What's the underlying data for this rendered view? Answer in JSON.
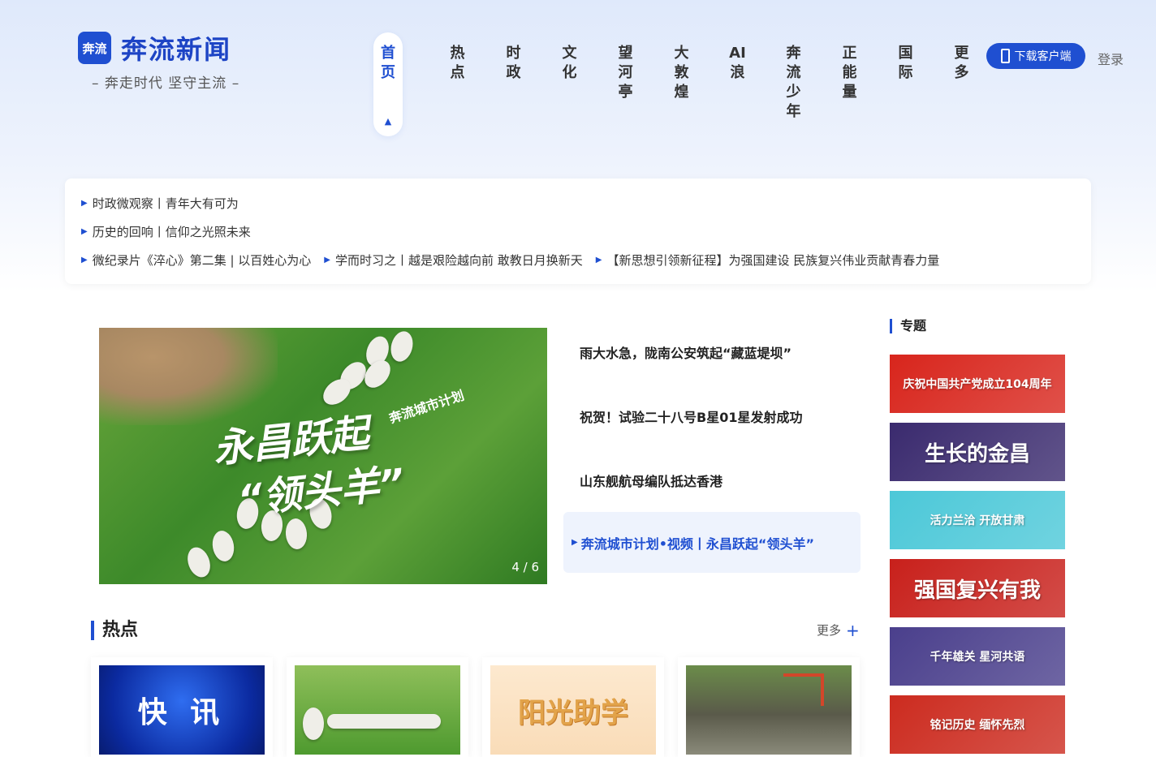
{
  "header": {
    "logo_badge": "奔流",
    "logo_text": "奔流新闻",
    "slogan": "– 奔走时代 坚守主流 –",
    "nav": [
      {
        "label": "首页",
        "active": true
      },
      {
        "label": "热点"
      },
      {
        "label": "时政"
      },
      {
        "label": "文化"
      },
      {
        "label": "望河亭"
      },
      {
        "label": "大敦煌"
      },
      {
        "label": "AI浪"
      },
      {
        "label": "奔流少年"
      },
      {
        "label": "正能量"
      },
      {
        "label": "国际"
      },
      {
        "label": "更多"
      }
    ],
    "download_label": "下载客户端",
    "login_label": "登录"
  },
  "top_links": {
    "row1": [
      "时政微观察丨青年大有可为"
    ],
    "row2": [
      "历史的回响丨信仰之光照未来"
    ],
    "row3": [
      "微纪录片《淬心》第二集 | 以百姓心为心",
      "学而时习之丨越是艰险越向前 敢教日月换新天",
      "【新思想引领新征程】为强国建设 民族复兴伟业贡献青春力量"
    ]
  },
  "carousel": {
    "title_main": "永昌跃起",
    "title_sub": "“领头羊”",
    "tagline": "奔流城市计划",
    "pager": "4 / 6"
  },
  "headlines": [
    "雨大水急，陇南公安筑起“藏蓝堤坝”",
    "祝贺！试验二十八号B星01星发射成功",
    "山东舰航母编队抵达香港"
  ],
  "headline_active": "奔流城市计划•视频丨永昌跃起“领头羊”",
  "topics": {
    "title": "专题",
    "banners": [
      {
        "text": "庆祝中国共产党成立104周年",
        "color": "#d8251c"
      },
      {
        "text": "生长的金昌",
        "color": "#3a2a6e"
      },
      {
        "text": "活力兰洽 开放甘肃",
        "color": "#4cc8d8"
      },
      {
        "text": "强国复兴有我",
        "color": "#c8201b"
      },
      {
        "text": "千年雄关 星河共语",
        "color": "#4a3f8c"
      },
      {
        "text": "铭记历史 缅怀先烈",
        "color": "#cc2b1f"
      }
    ]
  },
  "hot": {
    "title": "热点",
    "more_label": "更多",
    "cards": [
      {
        "thumb_text": "快 讯"
      },
      {
        "thumb_text": ""
      },
      {
        "thumb_text": "阳光助学"
      },
      {
        "thumb_text": ""
      }
    ]
  }
}
